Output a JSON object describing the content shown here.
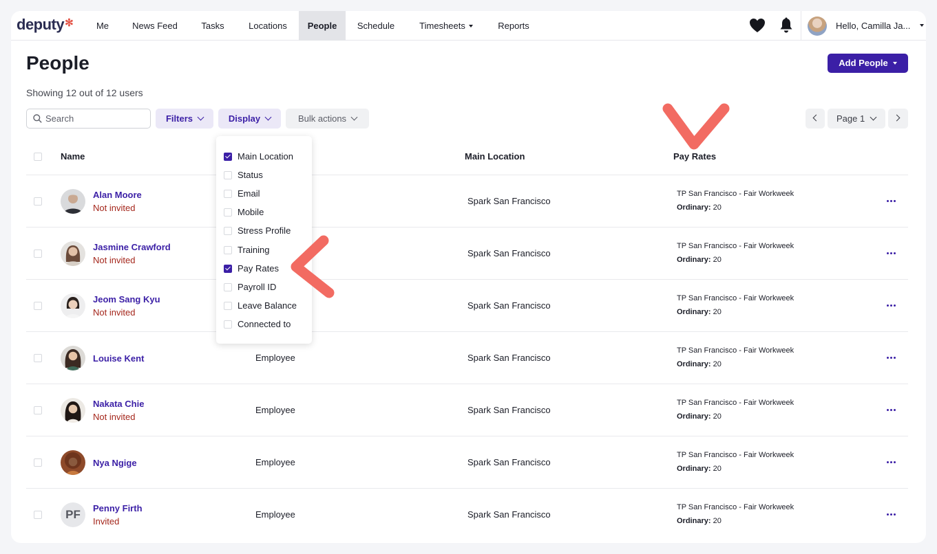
{
  "nav": {
    "logo": "deputy",
    "items": [
      "Me",
      "News Feed",
      "Tasks",
      "Locations",
      "People",
      "Schedule",
      "Timesheets",
      "Reports"
    ],
    "active": "People",
    "greeting": "Hello, Camilla Ja..."
  },
  "header": {
    "title": "People",
    "add_button": "Add People",
    "showing": "Showing 12 out of 12 users"
  },
  "toolbar": {
    "search_placeholder": "Search",
    "filters": "Filters",
    "display": "Display",
    "bulk": "Bulk actions",
    "page": "Page 1"
  },
  "table": {
    "columns": {
      "name": "Name",
      "location": "Main Location",
      "pay": "Pay Rates"
    },
    "rows": [
      {
        "name": "Alan Moore",
        "status": "Not invited",
        "role": "",
        "location": "Spark San Francisco",
        "pay_rate": "TP San Francisco - Fair Workweek",
        "ordinary_label": "Ordinary:",
        "ordinary_value": "20"
      },
      {
        "name": "Jasmine Crawford",
        "status": "Not invited",
        "role": "",
        "location": "Spark San Francisco",
        "pay_rate": "TP San Francisco - Fair Workweek",
        "ordinary_label": "Ordinary:",
        "ordinary_value": "20"
      },
      {
        "name": "Jeom Sang Kyu",
        "status": "Not invited",
        "role": "",
        "location": "Spark San Francisco",
        "pay_rate": "TP San Francisco - Fair Workweek",
        "ordinary_label": "Ordinary:",
        "ordinary_value": "20"
      },
      {
        "name": "Louise Kent",
        "status": "",
        "role": "Employee",
        "location": "Spark San Francisco",
        "pay_rate": "TP San Francisco - Fair Workweek",
        "ordinary_label": "Ordinary:",
        "ordinary_value": "20"
      },
      {
        "name": "Nakata Chie",
        "status": "Not invited",
        "role": "Employee",
        "location": "Spark San Francisco",
        "pay_rate": "TP San Francisco - Fair Workweek",
        "ordinary_label": "Ordinary:",
        "ordinary_value": "20"
      },
      {
        "name": "Nya Ngige",
        "status": "",
        "role": "Employee",
        "location": "Spark San Francisco",
        "pay_rate": "TP San Francisco - Fair Workweek",
        "ordinary_label": "Ordinary:",
        "ordinary_value": "20"
      },
      {
        "name": "Penny Firth",
        "status": "Invited",
        "role": "Employee",
        "location": "Spark San Francisco",
        "pay_rate": "TP San Francisco - Fair Workweek",
        "ordinary_label": "Ordinary:",
        "ordinary_value": "20",
        "initials": "PF"
      }
    ]
  },
  "display_menu": {
    "items": [
      {
        "label": "Main Location",
        "checked": true
      },
      {
        "label": "Status",
        "checked": false
      },
      {
        "label": "Email",
        "checked": false
      },
      {
        "label": "Mobile",
        "checked": false
      },
      {
        "label": "Stress Profile",
        "checked": false
      },
      {
        "label": "Training",
        "checked": false
      },
      {
        "label": "Pay Rates",
        "checked": true
      },
      {
        "label": "Payroll ID",
        "checked": false
      },
      {
        "label": "Leave Balance",
        "checked": false
      },
      {
        "label": "Connected to",
        "checked": false
      }
    ]
  },
  "colors": {
    "brand": "#3b1fa6",
    "annotation": "#f26b62",
    "not_invited": "#a4261b"
  }
}
